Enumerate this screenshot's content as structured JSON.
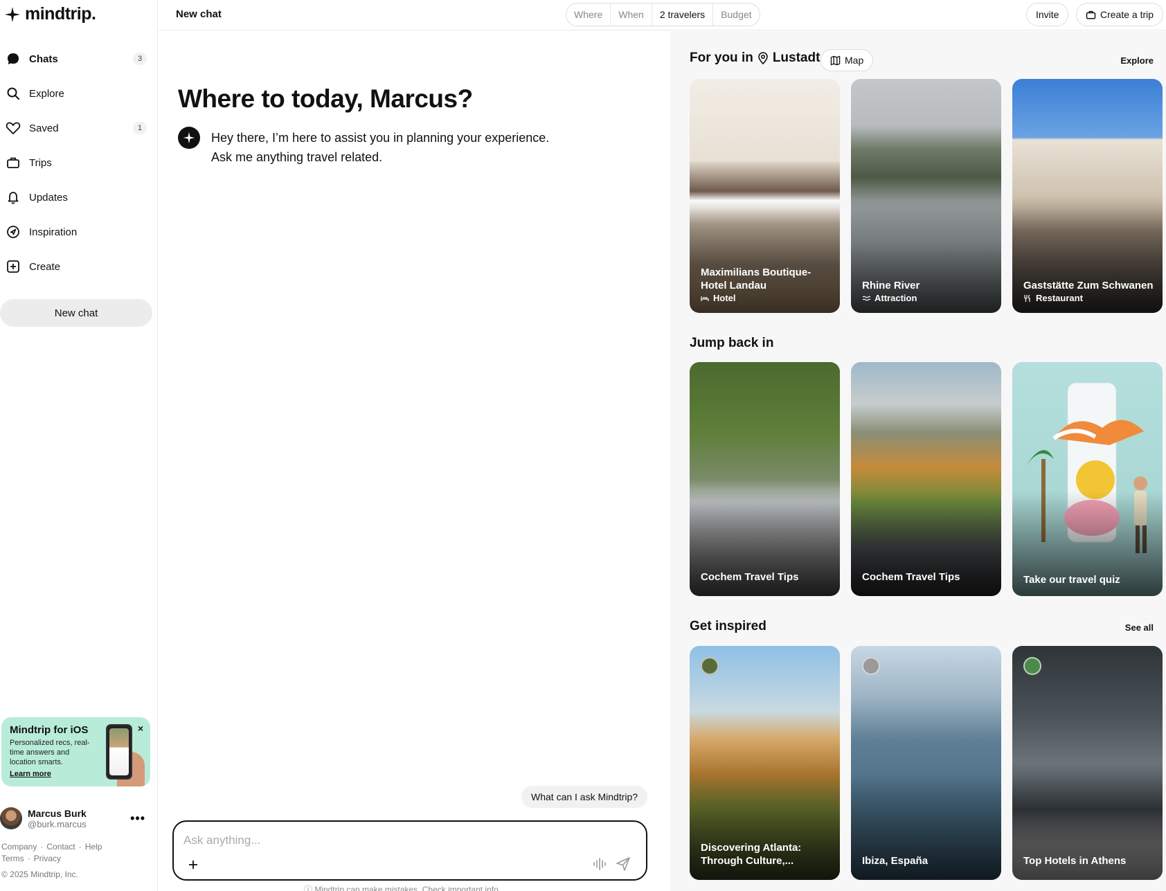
{
  "app": {
    "logo": "mindtrip."
  },
  "sidebar": {
    "items": [
      {
        "label": "Chats",
        "icon": "chat-bubble-icon",
        "count": "3"
      },
      {
        "label": "Explore",
        "icon": "search-icon",
        "count": ""
      },
      {
        "label": "Saved",
        "icon": "heart-icon",
        "count": "1"
      },
      {
        "label": "Trips",
        "icon": "suitcase-icon",
        "count": ""
      },
      {
        "label": "Updates",
        "icon": "bell-icon",
        "count": ""
      },
      {
        "label": "Inspiration",
        "icon": "compass-icon",
        "count": ""
      },
      {
        "label": "Create",
        "icon": "plus-square-icon",
        "count": ""
      }
    ],
    "new_chat": "New chat",
    "ios_promo": {
      "title": "Mindtrip for iOS",
      "description": "Personalized recs, real-time answers and location smarts.",
      "link": "Learn more",
      "close": "×"
    },
    "user": {
      "name": "Marcus Burk",
      "handle": "@burk.marcus",
      "more": "•••"
    },
    "footer": {
      "company": "Company",
      "contact": "Contact",
      "help": "Help",
      "terms": "Terms",
      "privacy": "Privacy",
      "copyright": "© 2025 Mindtrip, Inc."
    }
  },
  "topbar": {
    "title": "New chat",
    "filters": [
      {
        "label": "Where",
        "set": false
      },
      {
        "label": "When",
        "set": false
      },
      {
        "label": "2 travelers",
        "set": true
      },
      {
        "label": "Budget",
        "set": false
      }
    ],
    "invite": "Invite",
    "create_trip": "Create a trip"
  },
  "chat": {
    "greeting": "Where to today, Marcus?",
    "bot_line1": "Hey there, I’m here to assist you in planning your experience.",
    "bot_line2": "Ask me anything travel related.",
    "suggestion": "What can I ask Mindtrip?",
    "input_placeholder": "Ask anything...",
    "disclaimer": "Mindtrip can make mistakes. Check important info."
  },
  "panel": {
    "for_you_prefix": "For you in",
    "location": "Lustadt",
    "map_label": "Map",
    "explore_link": "Explore",
    "for_you_cards": [
      {
        "title": "Maximilians Boutique-Hotel Landau",
        "type": "Hotel",
        "type_icon": "bed-icon"
      },
      {
        "title": "Rhine River",
        "type": "Attraction",
        "type_icon": "waves-icon"
      },
      {
        "title": "Gaststätte Zum Schwanen",
        "type": "Restaurant",
        "type_icon": "utensils-icon"
      }
    ],
    "jump_back_title": "Jump back in",
    "jump_back_cards": [
      {
        "title": "Cochem Travel Tips"
      },
      {
        "title": "Cochem Travel Tips"
      },
      {
        "title": "Take our travel quiz"
      }
    ],
    "inspired_title": "Get inspired",
    "see_all": "See all",
    "inspired_cards": [
      {
        "title": "Discovering Atlanta: Through Culture,..."
      },
      {
        "title": "Ibiza, España"
      },
      {
        "title": "Top Hotels in Athens"
      }
    ]
  }
}
